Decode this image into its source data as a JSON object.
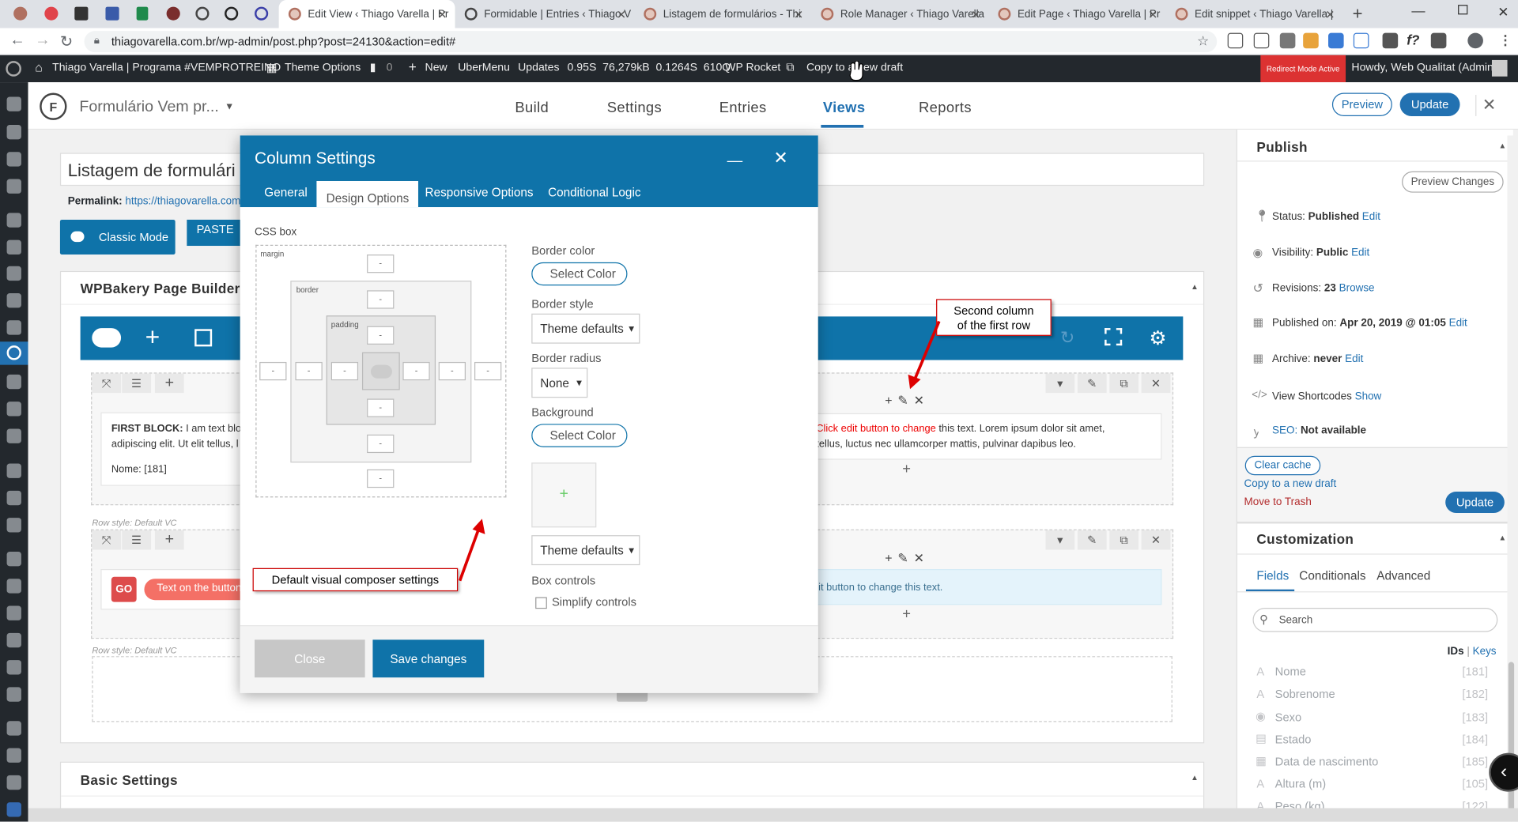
{
  "browser": {
    "tabs": [
      {
        "title": "Edit View ‹ Thiago Varella | Pr",
        "active": true
      },
      {
        "title": "Formidable | Entries ‹ Thiago V"
      },
      {
        "title": "Listagem de formulários - Thi"
      },
      {
        "title": "Role Manager ‹ Thiago Varella"
      },
      {
        "title": "Edit Page ‹ Thiago Varella | Pr"
      },
      {
        "title": "Edit snippet ‹ Thiago Varella | "
      }
    ],
    "url": "thiagovarella.com.br/wp-admin/post.php?post=24130&action=edit#"
  },
  "adminbar": {
    "site": "Thiago Varella | Programa #VEMPROTREINO",
    "theme_options": "Theme Options",
    "comments": "0",
    "new": "New",
    "ubermenu": "UberMenu",
    "updates": "Updates",
    "stats": "0.95S  76,279kB  0.1264S  610Q",
    "wprocket": "WP Rocket",
    "copy_draft": "Copy to a new draft",
    "redirect": "Redirect Mode Active",
    "howdy": "Howdy, Web Qualitat (Admin)"
  },
  "formidable": {
    "form_title": "Formulário Vem pr...",
    "tabs": [
      "Build",
      "Settings",
      "Entries",
      "Views",
      "Reports"
    ],
    "active_tab": "Views",
    "preview": "Preview",
    "update": "Update"
  },
  "post": {
    "title": "Listagem de formulári",
    "permalink_label": "Permalink:",
    "permalink_url": "https://thiagovarella.com.b",
    "classic_mode": "Classic Mode",
    "paste": "PASTE"
  },
  "wpbakery": {
    "title": "WPBakery Page Builder",
    "first_block_strong": "FIRST BLOCK:",
    "first_block_text": " I am text block",
    "first_block_line2": "adipiscing elit. Ut elit tellus, l",
    "nome_field": "Nome: [181]",
    "second_col_red": "Click edit button to change",
    "second_col_text": " this text. Lorem ipsum dolor sit amet,",
    "second_col_line2": "tellus, luctus nec ullamcorper mattis, pulvinar dapibus leo.",
    "row_style_label": "Row style: Default VC",
    "go_btn": "GO",
    "pill_text": "Text on the button",
    "second_row_text": "lit button to change this text.",
    "basic_settings": "Basic Settings"
  },
  "modal": {
    "title": "Column Settings",
    "tabs": [
      "General",
      "Design Options",
      "Responsive Options",
      "Conditional Logic"
    ],
    "active_tab": "Design Options",
    "css_box_label": "CSS box",
    "margin_label": "margin",
    "border_label": "border",
    "padding_label": "padding",
    "input_placeholder": "-",
    "border_color_label": "Border color",
    "border_color_btn": "Select Color",
    "border_style_label": "Border style",
    "border_style_value": "Theme defaults",
    "border_radius_label": "Border radius",
    "border_radius_value": "None",
    "background_label": "Background",
    "background_btn": "Select Color",
    "background_select": "Theme defaults",
    "box_controls_label": "Box controls",
    "simplify_controls": "Simplify controls",
    "close": "Close",
    "save": "Save changes"
  },
  "sidebar": {
    "publish_title": "Publish",
    "preview_changes": "Preview Changes",
    "status_label": "Status:",
    "status_value": "Published",
    "visibility_label": "Visibility:",
    "visibility_value": "Public",
    "revisions_label": "Revisions:",
    "revisions_value": "23",
    "browse": "Browse",
    "published_on_label": "Published on:",
    "published_on_value": "Apr 20, 2019 @ 01:05",
    "archive_label": "Archive:",
    "archive_value": "never",
    "edit": "Edit",
    "view_shortcodes": "View Shortcodes",
    "show": "Show",
    "seo_label": "SEO:",
    "seo_value": "Not available",
    "clear_cache": "Clear cache",
    "copy_draft": "Copy to a new draft",
    "move_trash": "Move to Trash",
    "update": "Update",
    "customization_title": "Customization",
    "cust_tabs": [
      "Fields",
      "Conditionals",
      "Advanced"
    ],
    "search_placeholder": "Search",
    "ids": "IDs",
    "keys": "Keys",
    "fields": [
      {
        "name": "Nome",
        "id": "[181]"
      },
      {
        "name": "Sobrenome",
        "id": "[182]"
      },
      {
        "name": "Sexo",
        "id": "[183]"
      },
      {
        "name": "Estado",
        "id": "[184]"
      },
      {
        "name": "Data de nascimento",
        "id": "[185]"
      },
      {
        "name": "Altura (m)",
        "id": "[105]"
      },
      {
        "name": "Peso (kg)",
        "id": "[122]"
      }
    ]
  },
  "annotations": {
    "second_column": "Second column\nof the first row",
    "default_settings": "Default visual composer settings"
  }
}
